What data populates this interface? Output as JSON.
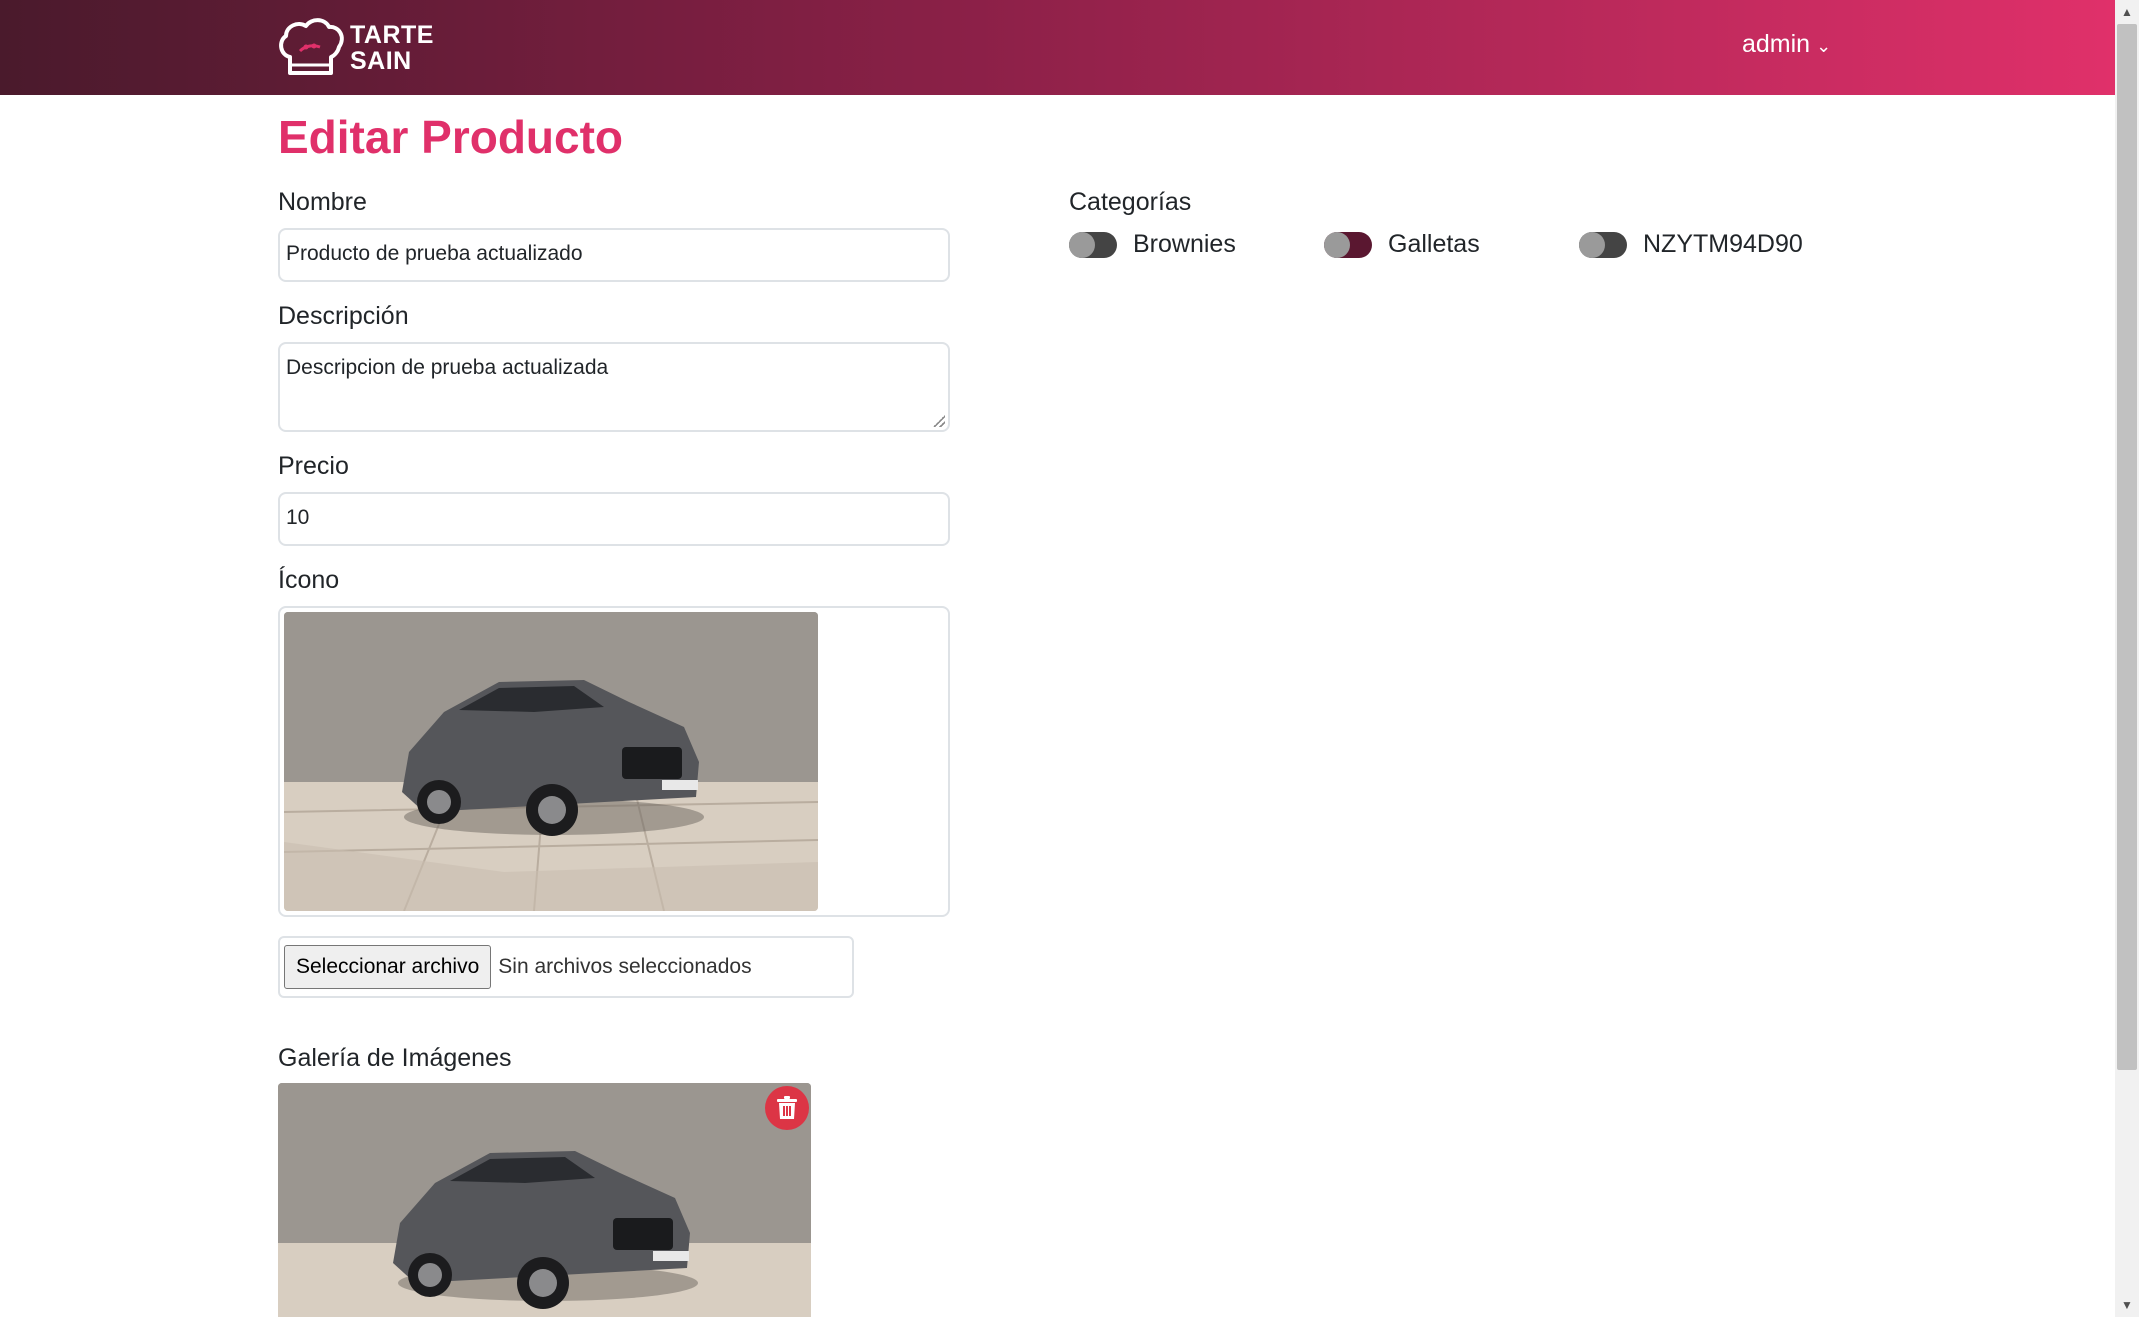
{
  "header": {
    "logo_line1": "TARTE",
    "logo_line2": "SAIN",
    "user_name": "admin",
    "gradient": [
      "#4a1a2c",
      "#8a2047",
      "#e0306a"
    ]
  },
  "page": {
    "title": "Editar Producto",
    "accent_color": "#e0306a"
  },
  "form": {
    "name_label": "Nombre",
    "name_value": "Producto de prueba actualizado",
    "description_label": "Descripción",
    "description_value": "Descripcion de prueba actualizada",
    "price_label": "Precio",
    "price_value": "10",
    "icon_label": "Ícono",
    "file_button_label": "Seleccionar archivo",
    "file_status": "Sin archivos seleccionados",
    "gallery_label": "Galería de Imágenes"
  },
  "categories": {
    "label": "Categorías",
    "items": [
      {
        "label": "Brownies",
        "checked": false
      },
      {
        "label": "Galletas",
        "checked": false
      },
      {
        "label": "NZYTM94D90",
        "checked": false
      }
    ]
  },
  "icons": {
    "logo": "chef-hat-icon",
    "user_chevron": "chevron-down-icon",
    "delete": "trash-icon"
  }
}
